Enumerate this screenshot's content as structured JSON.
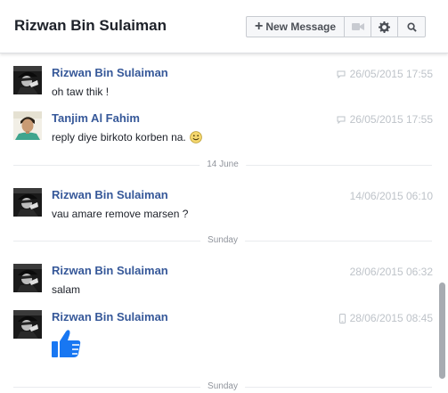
{
  "header": {
    "title": "Rizwan Bin Sulaiman",
    "new_message_label": "New Message"
  },
  "icons": {
    "new_message": "plus-icon",
    "video": "video-camera-icon",
    "settings": "gear-icon",
    "search": "search-icon",
    "chat_source": "chat-bubble-icon",
    "mobile_source": "mobile-phone-icon",
    "smiley": "smiley-icon",
    "like": "thumbs-up-icon"
  },
  "colors": {
    "sender_name": "#365899",
    "timestamp": "#bec3c9",
    "like_blue": "#1877f2",
    "divider_text": "#90949c"
  },
  "messages": [
    {
      "sender": "Rizwan Bin Sulaiman",
      "timestamp": "26/05/2015 17:55",
      "text": "oh taw thik !",
      "source": "chat"
    },
    {
      "sender": "Tanjim Al Fahim",
      "timestamp": "26/05/2015 17:55",
      "text": "reply diye birkoto korben na.",
      "source": "chat",
      "emoji": "smiley"
    },
    {
      "sender": "Rizwan Bin Sulaiman",
      "timestamp": "14/06/2015 06:10",
      "text": "vau amare remove marsen ?",
      "source": ""
    },
    {
      "sender": "Rizwan Bin Sulaiman",
      "timestamp": "28/06/2015 06:32",
      "text": "salam",
      "source": ""
    },
    {
      "sender": "Rizwan Bin Sulaiman",
      "timestamp": "28/06/2015 08:45",
      "text": "",
      "source": "mobile",
      "sticker": "like"
    }
  ],
  "dividers": [
    "14 June",
    "Sunday",
    "Sunday"
  ]
}
